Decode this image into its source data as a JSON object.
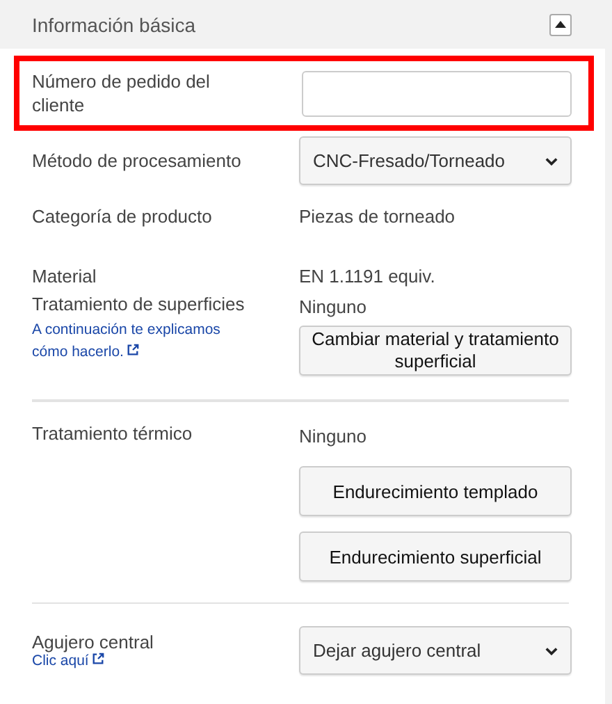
{
  "section": {
    "title": "Información básica",
    "expanded": true
  },
  "order_number": {
    "label": "Número de pedido del cliente",
    "highlighted": true
  },
  "processing_method": {
    "label": "Método de procesamiento",
    "value": "CNC-Fresado/Torneado"
  },
  "product_category": {
    "label": "Categoría de producto",
    "value": "Piezas de torneado"
  },
  "material": {
    "label": "Material",
    "value": "EN 1.1191 equiv."
  },
  "surface_treatment": {
    "label": "Tratamiento de superficies",
    "link": "A continuación te explicamos cómo hacerlo.",
    "value": "Ninguno",
    "button": "Cambiar material y tratamiento superficial"
  },
  "heat_treatment": {
    "label": "Tratamiento térmico",
    "value": "Ninguno",
    "buttons": [
      "Endurecimiento templado",
      "Endurecimiento superficial"
    ]
  },
  "center_hole": {
    "label": "Agujero central",
    "link": "Clic aquí",
    "value": "Dejar agujero central"
  }
}
